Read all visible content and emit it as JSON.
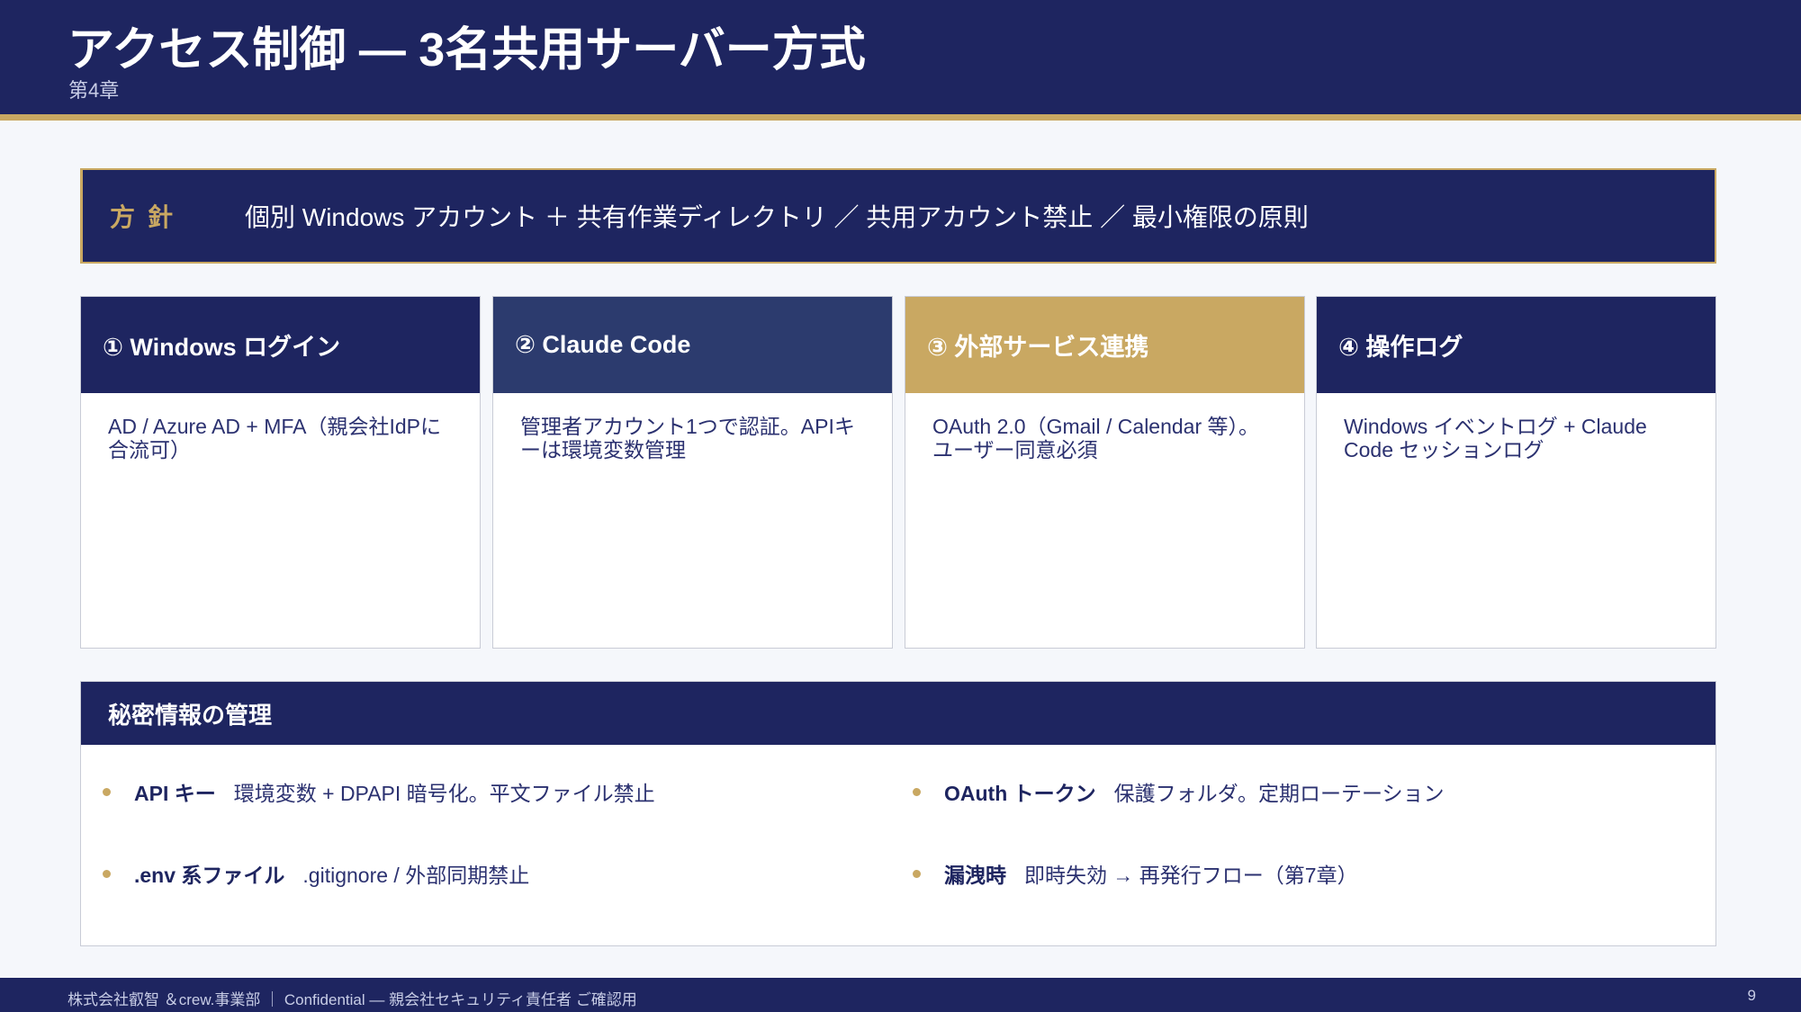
{
  "header": {
    "title": "アクセス制御 — 3名共用サーバー方式",
    "chapter": "第4章"
  },
  "policy": {
    "label": "方針",
    "text": "個別 Windows アカウント ＋ 共有作業ディレクトリ ／ 共用アカウント禁止 ／ 最小権限の原則"
  },
  "cards": [
    {
      "title": "① Windows ログイン",
      "body": "AD / Azure AD + MFA（親会社IdPに合流可）",
      "color": "#1e2560"
    },
    {
      "title": "② Claude Code",
      "body": "管理者アカウント1つで認証。APIキーは環境変数管理",
      "color": "#2c3b6e"
    },
    {
      "title": "③ 外部サービス連携",
      "body": "OAuth 2.0（Gmail / Calendar 等）。ユーザー同意必須",
      "color": "#c9a862"
    },
    {
      "title": "④ 操作ログ",
      "body": "Windows イベントログ + Claude Code セッションログ",
      "color": "#1e2560"
    }
  ],
  "secrets": {
    "title": "秘密情報の管理",
    "items": [
      {
        "key": "API キー",
        "value": "環境変数 + DPAPI 暗号化。平文ファイル禁止"
      },
      {
        "key": "OAuth トークン",
        "value": "保護フォルダ。定期ローテーション"
      },
      {
        "key": ".env 系ファイル",
        "value": ".gitignore / 外部同期禁止"
      },
      {
        "key": "漏洩時",
        "value": "即時失効 → 再発行フロー（第7章）"
      }
    ]
  },
  "footer": {
    "text": "株式会社叡智 ＆crew.事業部 ｜ Confidential — 親会社セキュリティ責任者 ご確認用",
    "page": "9"
  },
  "colors": {
    "navy": "#1e2560",
    "gold": "#c9a862",
    "slate": "#2c3b6e"
  }
}
